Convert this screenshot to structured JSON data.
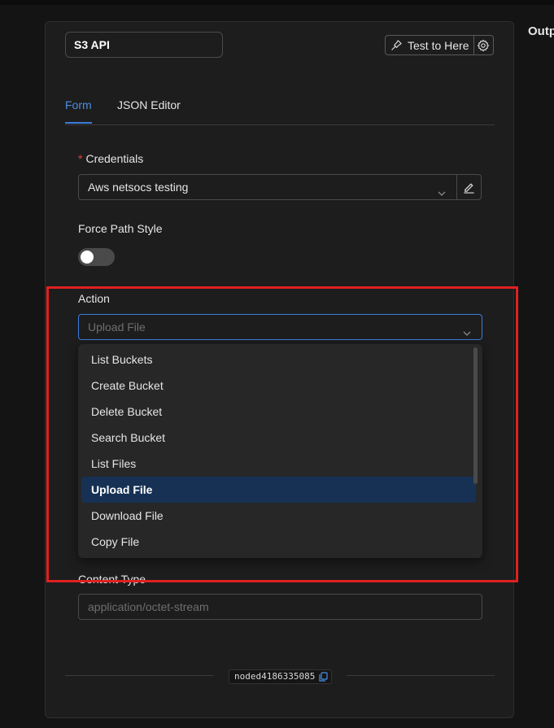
{
  "right_panel": {
    "label": "Outp"
  },
  "header": {
    "node_name": "S3 API",
    "test_button_label": "Test to Here"
  },
  "tabs": [
    {
      "label": "Form",
      "active": true
    },
    {
      "label": "JSON Editor",
      "active": false
    }
  ],
  "form": {
    "credentials": {
      "required_mark": "*",
      "label": "Credentials",
      "value": "Aws netsocs testing"
    },
    "force_path_style": {
      "label": "Force Path Style",
      "enabled": false
    },
    "action": {
      "label": "Action",
      "placeholder": "Upload File",
      "options": [
        "List Buckets",
        "Create Bucket",
        "Delete Bucket",
        "Search Bucket",
        "List Files",
        "Upload File",
        "Download File",
        "Copy File"
      ],
      "selected_option": "Upload File"
    },
    "content_type": {
      "label": "Content Type",
      "placeholder": "application/octet-stream"
    }
  },
  "footer": {
    "node_id": "noded4186335085"
  },
  "colors": {
    "accent": "#3b7ddd",
    "selected_option_bg": "#163154",
    "highlight_border": "#e02020",
    "required": "#e0453c"
  }
}
